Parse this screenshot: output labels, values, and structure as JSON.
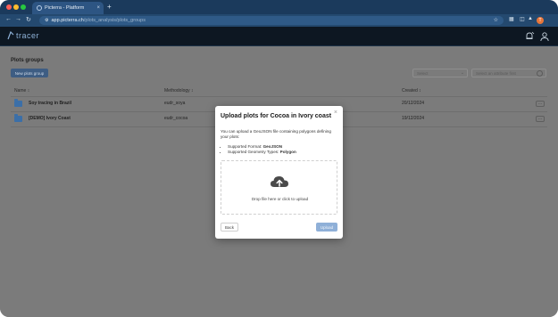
{
  "browser": {
    "tab_title": "Picterra - Platform",
    "tab_close": "×",
    "new_tab": "+",
    "url_host": "app.picterra.ch",
    "url_path": "/plots_analysis/plots_groups",
    "profile_initial": "T",
    "icons": [
      "back-icon",
      "forward-icon",
      "reload-icon",
      "site-info-icon",
      "bookmark-star-icon",
      "extensions-icon",
      "split-view-icon",
      "extension-icon"
    ]
  },
  "app": {
    "logo_text": "tracer",
    "header_icons": [
      "notifications-icon",
      "user-icon"
    ]
  },
  "page": {
    "title": "Plots groups",
    "new_button": "New plots group",
    "select_placeholder": "Select",
    "search_placeholder": "Select an attribute first",
    "columns": {
      "name": "Name ↕",
      "methodology": "Methodology ↕",
      "created": "Created ↕"
    },
    "rows": [
      {
        "name": "Soy tracing in Brazil",
        "methodology": "eudr_soya",
        "created": "20/12/2024",
        "more": "⋯"
      },
      {
        "name": "[DEMO] Ivory Coast",
        "methodology": "eudr_cocoa",
        "created": "19/12/2024",
        "more": "⋯"
      }
    ]
  },
  "modal": {
    "title": "Upload plots for Cocoa in Ivory coast",
    "close": "×",
    "description": "You can upload a GeoJSON file containing polygons defining your plots:",
    "format_label": "Supported Format: ",
    "format_value": "GeoJSON",
    "geometry_label": "Supported Geometry Types: ",
    "geometry_value": "Polygon",
    "drop_text": "Drop file here or click to upload",
    "back": "Back",
    "upload": "Upload"
  },
  "colors": {
    "chrome": "#1b3a5c",
    "app_header": "#0d1722",
    "primary": "#3e5d83",
    "upload_disabled": "#8fb0d8",
    "overlay": "#7b7b7b"
  }
}
